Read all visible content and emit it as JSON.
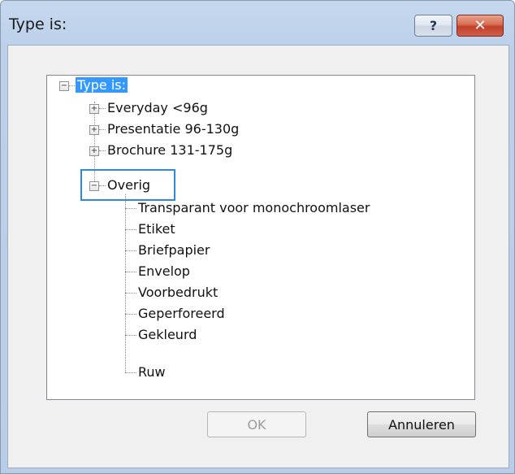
{
  "window": {
    "title": "Type is:",
    "help_label": "?",
    "close_label": "✕"
  },
  "tree": {
    "root": "Type is:",
    "groups": [
      {
        "label": "Everyday <96g",
        "expander": "+"
      },
      {
        "label": "Presentatie 96-130g",
        "expander": "+"
      },
      {
        "label": "Brochure 131-175g",
        "expander": "+"
      },
      {
        "label": "Overig",
        "expander": "−"
      }
    ],
    "overig_items": [
      "Transparant voor monochroomlaser",
      "Etiket",
      "Briefpapier",
      "Envelop",
      "Voorbedrukt",
      "Geperforeerd",
      "Gekleurd",
      "Ruw"
    ]
  },
  "buttons": {
    "ok": "OK",
    "cancel": "Annuleren"
  }
}
